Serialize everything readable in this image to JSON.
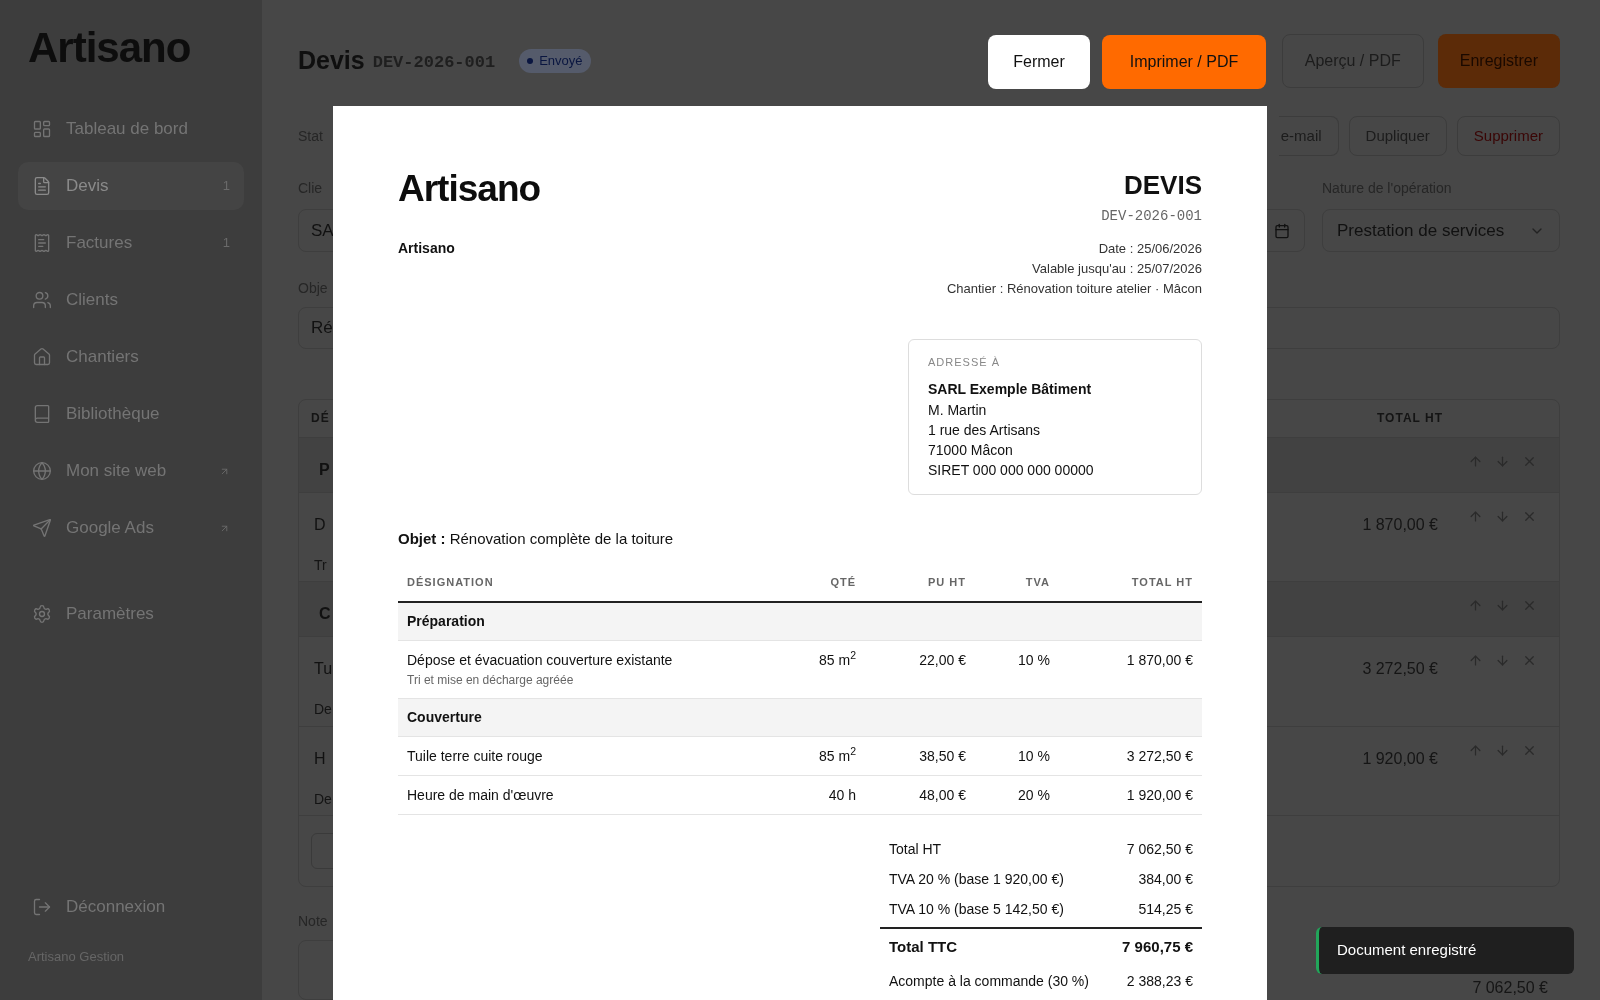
{
  "sidebar": {
    "logo": "Artisano",
    "items": [
      {
        "label": "Tableau de bord",
        "selected": false,
        "external": false
      },
      {
        "label": "Devis",
        "selected": true,
        "external": false,
        "count": "1"
      },
      {
        "label": "Factures",
        "selected": false,
        "external": false,
        "count": "1"
      },
      {
        "label": "Clients",
        "selected": false,
        "external": false
      },
      {
        "label": "Chantiers",
        "selected": false,
        "external": false
      },
      {
        "label": "Bibliothèque",
        "selected": false,
        "external": false
      },
      {
        "label": "Mon site web",
        "selected": false,
        "external": true
      },
      {
        "label": "Google Ads",
        "selected": false,
        "external": true
      }
    ],
    "settings": "Paramètres",
    "logout": "Déconnexion",
    "footer": "Artisano Gestion"
  },
  "page": {
    "title": "Devis",
    "number": "DEV-2026-001",
    "status": "Envoyé",
    "actions": [
      {
        "label": "Aperçu / PDF",
        "kind": "default"
      },
      {
        "label": "Enregistrer",
        "kind": "primary"
      }
    ],
    "secondary_actions": [
      {
        "label": "e-mail",
        "kind": "default"
      },
      {
        "label": "Dupliquer",
        "kind": "default"
      },
      {
        "label": "Supprimer",
        "kind": "danger"
      }
    ],
    "status_label": "Stat",
    "client_label": "Clie",
    "client_value": "SA",
    "operation_label": "Nature de l'opération",
    "operation_value": "Prestation de services",
    "object_label": "Obje",
    "object_value": "Ré",
    "table": {
      "column_1": "DÉ",
      "total_column": "TOTAL HT",
      "rows": [
        {
          "kind": "group",
          "text": "P"
        },
        {
          "kind": "item",
          "text": "D",
          "note": "Tr",
          "total": "1 870,00 €"
        },
        {
          "kind": "group",
          "text": "C"
        },
        {
          "kind": "item",
          "text": "Tu",
          "note": "De",
          "total": "3 272,50 €"
        },
        {
          "kind": "item",
          "text": "H",
          "note": "De",
          "total": "1 920,00 €"
        }
      ]
    },
    "notes_label": "Note",
    "summary_total": "7 062,50 €"
  },
  "modal": {
    "buttons": [
      {
        "label": "Fermer",
        "kind": "secondary"
      },
      {
        "label": "Imprimer / PDF",
        "kind": "primary"
      }
    ],
    "document": {
      "logo": "Artisano",
      "sender": "Artisano",
      "title": "DEVIS",
      "number": "DEV-2026-001",
      "meta": [
        "Date : 25/06/2026",
        "Valable jusqu'au : 25/07/2026",
        "Chantier : Rénovation toiture atelier · Mâcon"
      ],
      "address": {
        "label": "ADRESSÉ À",
        "name": "SARL Exemple Bâtiment",
        "lines": [
          "M. Martin",
          "1 rue des Artisans",
          "71000 Mâcon",
          "SIRET 000 000 000 00000"
        ]
      },
      "object": "**Objet :** Rénovation complète de la toiture",
      "columns": [
        "DÉSIGNATION",
        "QTÉ",
        "PU HT",
        "TVA",
        "TOTAL HT"
      ],
      "rows": [
        {
          "kind": "group",
          "designation": "Préparation"
        },
        {
          "kind": "item",
          "designation": "Dépose et évacuation couverture existante",
          "note": "Tri et mise en décharge agréée",
          "qty": "85 m$^{2}$",
          "unit_price": "22,00 €",
          "vat": "10 %",
          "total": "1 870,00 €"
        },
        {
          "kind": "group",
          "designation": "Couverture"
        },
        {
          "kind": "item",
          "designation": "Tuile terre cuite rouge",
          "qty": "85 m$^{2}$",
          "unit_price": "38,50 €",
          "vat": "10 %",
          "total": "3 272,50 €"
        },
        {
          "kind": "item",
          "designation": "Heure de main d'œuvre",
          "qty": "40 h",
          "unit_price": "48,00 €",
          "vat": "20 %",
          "total": "1 920,00 €"
        }
      ],
      "totals": [
        {
          "kind": "line",
          "label": "Total HT",
          "value": "7 062,50 €"
        },
        {
          "kind": "line",
          "label": "TVA 20 % (base 1 920,00 €)",
          "value": "384,00 €"
        },
        {
          "kind": "line",
          "label": "TVA 10 % (base 5 142,50 €)",
          "value": "514,25 €"
        },
        {
          "kind": "grand",
          "label": "Total TTC",
          "value": "7 960,75 €"
        },
        {
          "kind": "line",
          "label": "Acompte à la commande (30 %)",
          "value": "2 388,23 €"
        }
      ]
    }
  },
  "toast": {
    "text": "Document enregistré"
  }
}
